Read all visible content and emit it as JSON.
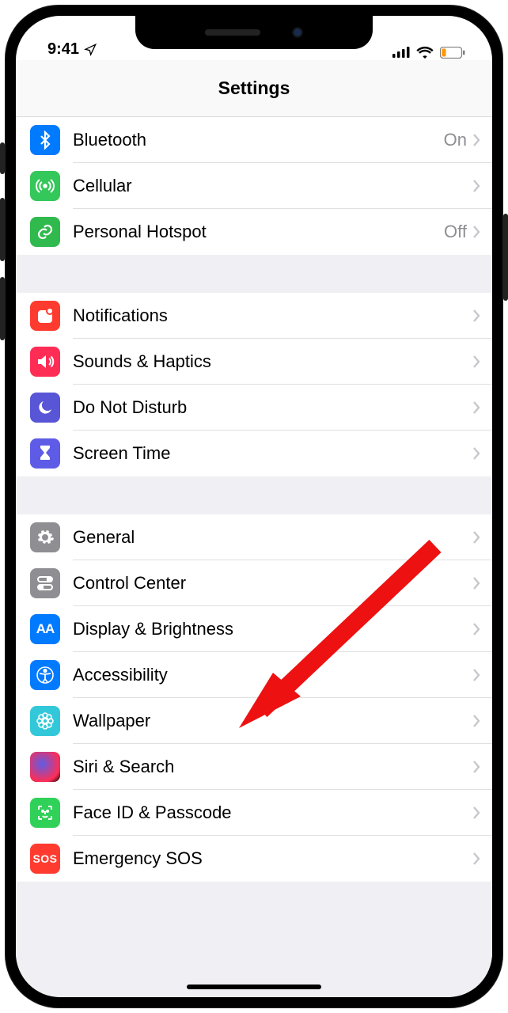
{
  "statusbar": {
    "time": "9:41"
  },
  "header": {
    "title": "Settings"
  },
  "groups": [
    {
      "rows": [
        {
          "id": "bluetooth",
          "label": "Bluetooth",
          "value": "On",
          "icon": "bluetooth",
          "color": "bg-blue"
        },
        {
          "id": "cellular",
          "label": "Cellular",
          "value": "",
          "icon": "antenna",
          "color": "bg-green"
        },
        {
          "id": "hotspot",
          "label": "Personal Hotspot",
          "value": "Off",
          "icon": "link",
          "color": "bg-green2"
        }
      ]
    },
    {
      "rows": [
        {
          "id": "notifications",
          "label": "Notifications",
          "value": "",
          "icon": "notif",
          "color": "bg-red"
        },
        {
          "id": "sounds",
          "label": "Sounds & Haptics",
          "value": "",
          "icon": "sound",
          "color": "bg-pink"
        },
        {
          "id": "dnd",
          "label": "Do Not Disturb",
          "value": "",
          "icon": "moon",
          "color": "bg-purple"
        },
        {
          "id": "screentime",
          "label": "Screen Time",
          "value": "",
          "icon": "hourglass",
          "color": "bg-purple2"
        }
      ]
    },
    {
      "rows": [
        {
          "id": "general",
          "label": "General",
          "value": "",
          "icon": "gear",
          "color": "bg-gray"
        },
        {
          "id": "controlcenter",
          "label": "Control Center",
          "value": "",
          "icon": "switches",
          "color": "bg-gray2"
        },
        {
          "id": "display",
          "label": "Display & Brightness",
          "value": "",
          "icon": "aa",
          "color": "bg-blue"
        },
        {
          "id": "accessibility",
          "label": "Accessibility",
          "value": "",
          "icon": "access",
          "color": "bg-blue2"
        },
        {
          "id": "wallpaper",
          "label": "Wallpaper",
          "value": "",
          "icon": "flower",
          "color": "bg-teal"
        },
        {
          "id": "siri",
          "label": "Siri & Search",
          "value": "",
          "icon": "siri",
          "color": "bg-siri"
        },
        {
          "id": "faceid",
          "label": "Face ID & Passcode",
          "value": "",
          "icon": "face",
          "color": "bg-fgreen"
        },
        {
          "id": "sos",
          "label": "Emergency SOS",
          "value": "",
          "icon": "sos",
          "color": "bg-sos"
        }
      ]
    }
  ],
  "annotation": {
    "target": "accessibility"
  }
}
